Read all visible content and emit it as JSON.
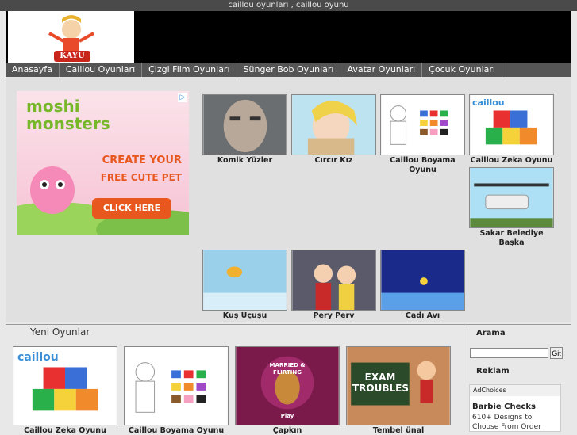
{
  "topbar": {
    "text": "caillou oyunları , caillou oyunu"
  },
  "logo": {
    "text": "KAYU"
  },
  "nav": [
    "Anasayfa",
    "Caillou Oyunları",
    "Çizgi Film Oyunları",
    "Sünger Bob Oyunları",
    "Avatar Oyunları",
    "Çocuk Oyunları"
  ],
  "ad": {
    "brand": "moshi monsters",
    "line1": "CREATE YOUR",
    "line2": "FREE CUTE PET",
    "cta": "CLICK HERE"
  },
  "games": [
    {
      "title": "Komik Yüzler"
    },
    {
      "title": "Cırcır Kız"
    },
    {
      "title": "Caillou Boyama Oyunu"
    },
    {
      "title": "Caillou Zeka Oyunu"
    },
    {
      "title": "Sakar Belediye Başka"
    },
    {
      "title": "Kuş Uçuşu"
    },
    {
      "title": "Pery Perv"
    },
    {
      "title": "Cadı Avı"
    }
  ],
  "new_games": {
    "title": "Yeni Oyunlar",
    "items": [
      {
        "title": "Caillou Zeka Oyunu"
      },
      {
        "title": "Caillou Boyama Oyunu"
      },
      {
        "title": "Çapkın"
      },
      {
        "title": "Tembel ünal"
      }
    ]
  },
  "thumb_text": {
    "caillou": "caillou",
    "married": "MARRIED & FLIRTING",
    "exam": "EXAM TROUBLES",
    "play": "Play"
  },
  "sidebar": {
    "search_title": "Arama",
    "search_button": "Git",
    "ads_title": "Reklam",
    "adchoices": "AdChoices",
    "ad_title": "Barbie Checks",
    "ad_line1": "610+ Designs to",
    "ad_line2": "Choose From Order"
  },
  "colors": {
    "nav_bg": "#555555",
    "header_bg": "#000000",
    "link": "#3a5fa8"
  }
}
